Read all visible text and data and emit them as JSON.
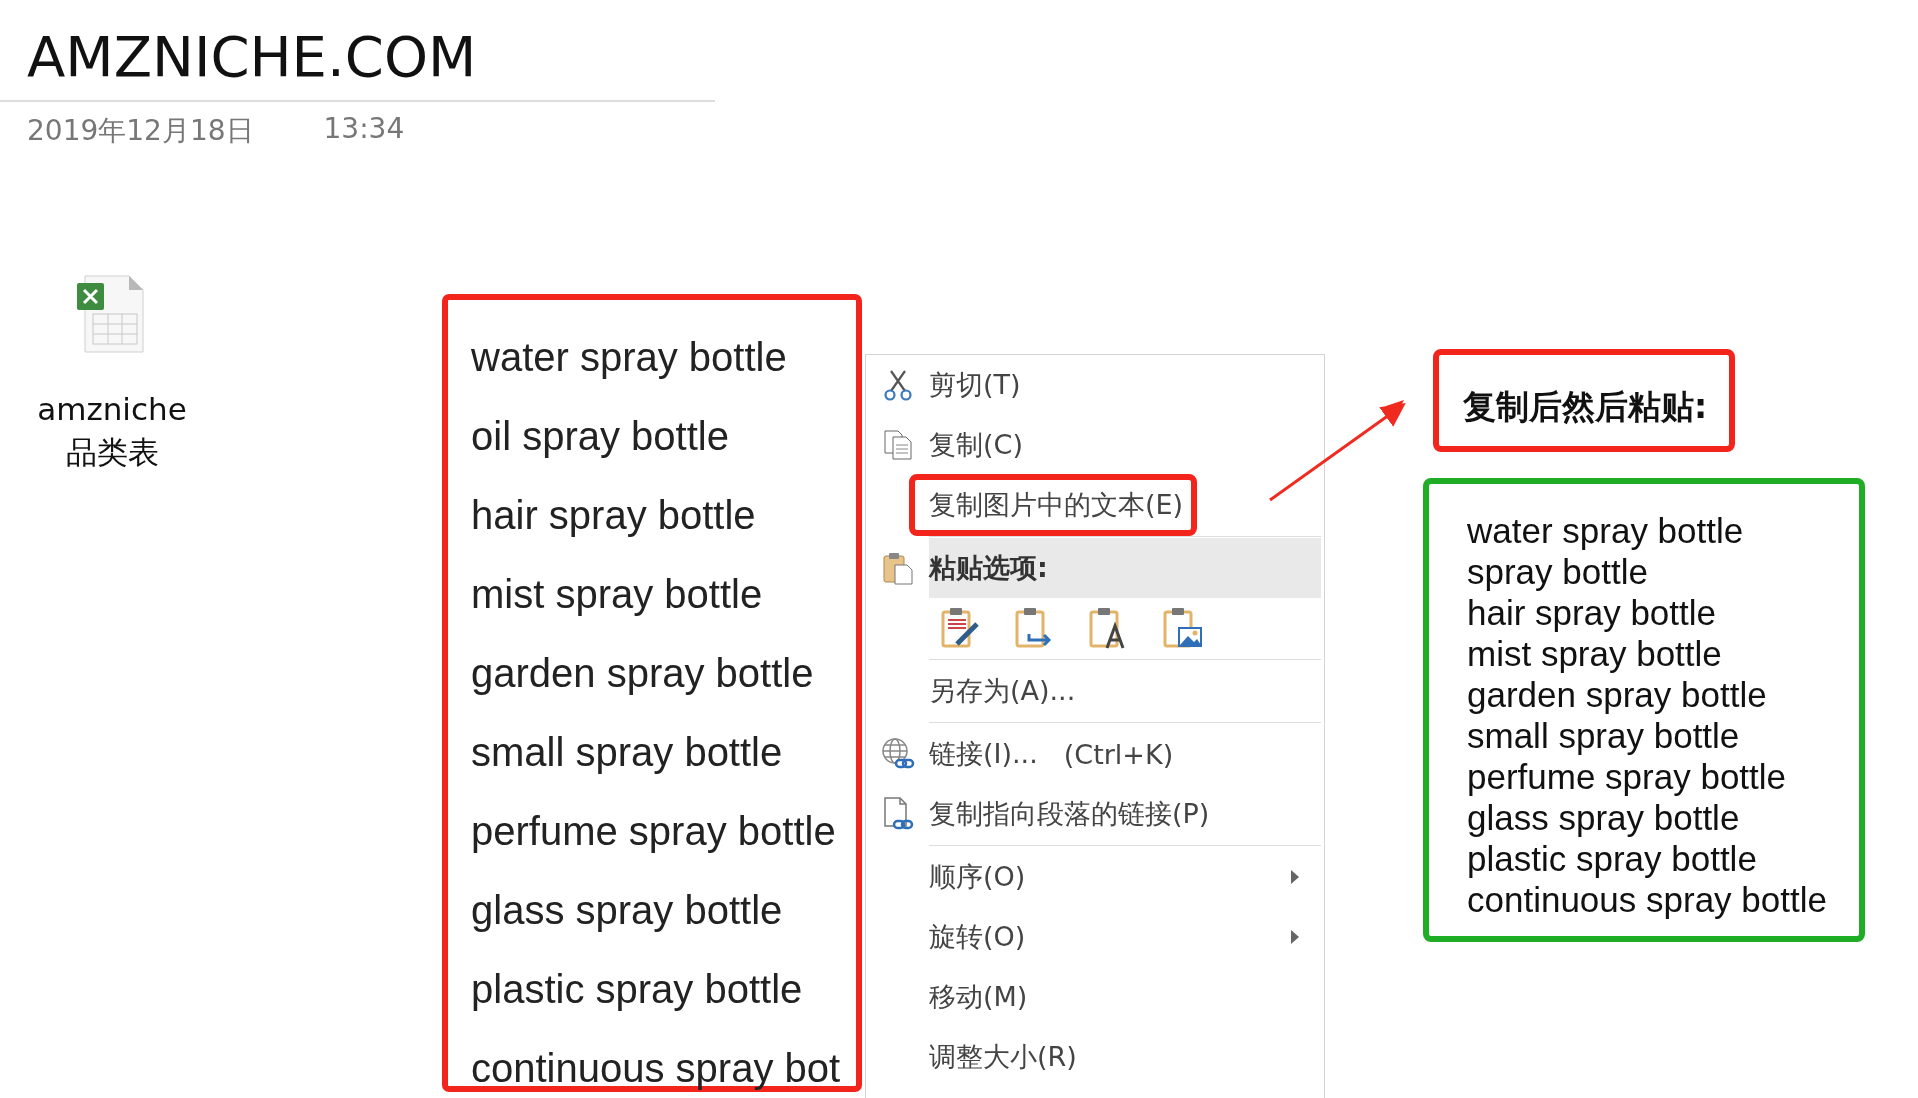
{
  "page": {
    "title": "AMZNICHE.COM",
    "date": "2019年12月18日",
    "time": "13:34"
  },
  "attachment": {
    "name_lines": [
      "amzniche",
      "品类表"
    ]
  },
  "keyword_list": {
    "items": [
      "water spray bottle",
      "oil spray bottle",
      "hair spray bottle",
      "mist spray bottle",
      "garden spray bottle",
      "small spray bottle",
      "perfume spray bottle",
      "glass spray bottle",
      "plastic spray bottle",
      "continuous spray bot"
    ]
  },
  "context_menu": {
    "groups": [
      [
        {
          "kind": "item",
          "label": "剪切(T)",
          "hovered": false,
          "annotated": false,
          "submenu": false
        },
        {
          "kind": "item",
          "label": "复制(C)",
          "hovered": false,
          "annotated": false,
          "submenu": false
        },
        {
          "kind": "item",
          "label": "复制图片中的文本(E)",
          "hovered": false,
          "annotated": true,
          "submenu": false
        }
      ],
      [
        {
          "kind": "header",
          "label": "粘贴选项:",
          "hovered": true,
          "annotated": false,
          "submenu": false
        },
        {
          "kind": "paste_options"
        }
      ],
      [
        {
          "kind": "item",
          "label": "另存为(A)...",
          "hovered": false,
          "annotated": false,
          "submenu": false
        }
      ],
      [
        {
          "kind": "item",
          "label": "链接(I)...",
          "shortcut": "(Ctrl+K)",
          "hovered": false,
          "annotated": false,
          "submenu": false
        },
        {
          "kind": "item",
          "label": "复制指向段落的链接(P)",
          "hovered": false,
          "annotated": false,
          "submenu": false
        }
      ],
      [
        {
          "kind": "item",
          "label": "顺序(O)",
          "hovered": false,
          "annotated": false,
          "submenu": true
        },
        {
          "kind": "item",
          "label": "旋转(O)",
          "hovered": false,
          "annotated": false,
          "submenu": true
        },
        {
          "kind": "item",
          "label": "移动(M)",
          "hovered": false,
          "annotated": false,
          "submenu": false
        },
        {
          "kind": "item",
          "label": "调整大小(R)",
          "hovered": false,
          "annotated": false,
          "submenu": false
        }
      ]
    ]
  },
  "result_note": {
    "caption": "复制后然后粘贴:",
    "lines": [
      "water spray bottle",
      "spray bottle",
      "hair spray bottle",
      "mist spray bottle",
      "garden spray bottle",
      "small spray bottle",
      "perfume spray bottle",
      "glass spray bottle",
      "plastic spray bottle",
      "continuous spray bottle"
    ]
  }
}
